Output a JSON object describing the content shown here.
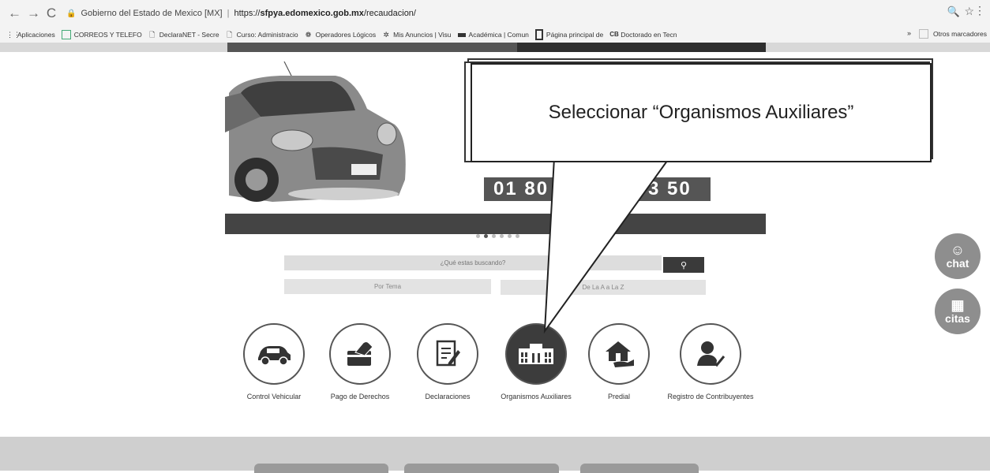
{
  "browser": {
    "site_name": "Gobierno del Estado de Mexico [MX]",
    "separator": "|",
    "url_prefix": "https://",
    "url_host": "sfpya.edomexico.gob.mx",
    "url_path": "/recaudacion/"
  },
  "bookmarks": {
    "items": [
      {
        "label": "Aplicaciones",
        "icon": "apps-grid-icon"
      },
      {
        "label": "CORREOS Y TELEFO",
        "icon": "table-icon"
      },
      {
        "label": "DeclaraNET - Secre",
        "icon": "page-icon"
      },
      {
        "label": "Curso: Administracio",
        "icon": "page-icon"
      },
      {
        "label": "Operadores Lógicos",
        "icon": "leaf-icon"
      },
      {
        "label": "Mis Anuncios | Visu",
        "icon": "ads-icon"
      },
      {
        "label": "Académica | Comun",
        "icon": "school-icon"
      },
      {
        "label": "Página principal de",
        "icon": "book-icon"
      },
      {
        "label": "Doctorado en Tecn",
        "icon": "cb-icon"
      }
    ],
    "more": "»",
    "other": "Otros marcadores"
  },
  "banner": {
    "phone_part_1": "01 80",
    "phone_part_2": "3 50"
  },
  "search": {
    "placeholder": "¿Qué estas buscando?",
    "button_icon": "search-icon",
    "tab_tema": "Por Tema",
    "tab_az": "De La A a La Z"
  },
  "services": [
    {
      "label": "Control Vehicular",
      "icon": "car-icon"
    },
    {
      "label": "Pago de Derechos",
      "icon": "card-payment-icon"
    },
    {
      "label": "Declaraciones",
      "icon": "document-edit-icon"
    },
    {
      "label": "Organismos Auxiliares",
      "icon": "building-icon"
    },
    {
      "label": "Predial",
      "icon": "house-hand-icon"
    },
    {
      "label": "Registro de Contribuyentes",
      "icon": "user-check-icon"
    }
  ],
  "floating": {
    "chat": "chat",
    "citas": "citas"
  },
  "annotation": {
    "text": "Seleccionar “Organismos Auxiliares”"
  },
  "colors": {
    "active_service": "#3c3c3c",
    "annotation_border": "#222222"
  }
}
